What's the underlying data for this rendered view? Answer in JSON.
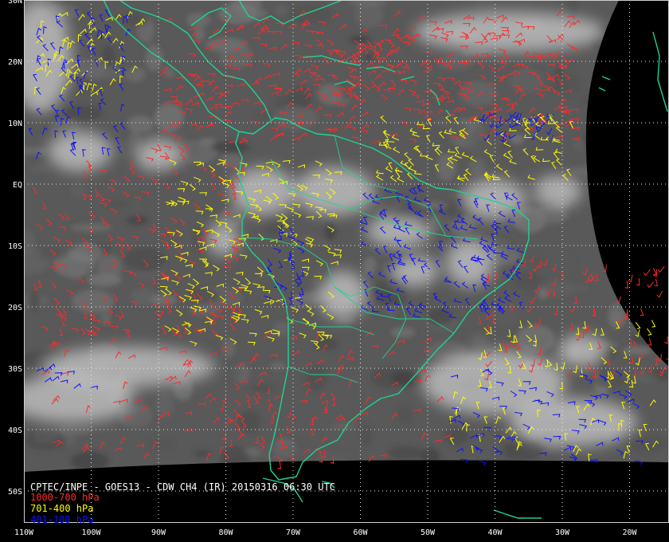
{
  "map": {
    "title": "CPTEC/INPE - GOES13 - CDW CH4 (IR) 20150316 06:30 UTC",
    "latitude_labels": [
      "30N",
      "20N",
      "10N",
      "EQ",
      "10S",
      "20S",
      "30S",
      "40S",
      "50S"
    ],
    "longitude_labels": [
      "110W",
      "100W",
      "90W",
      "80W",
      "70W",
      "60W",
      "50W",
      "40W",
      "30W",
      "20W"
    ],
    "lat_values": [
      30,
      20,
      10,
      0,
      -10,
      -20,
      -30,
      -40,
      -50
    ],
    "lon_values": [
      -110,
      -100,
      -90,
      -80,
      -70,
      -60,
      -50,
      -40,
      -30,
      -20
    ],
    "legend": [
      {
        "label": "1000-700 hPa",
        "color": "#ff2a2a"
      },
      {
        "label": "701-400 hPa",
        "color": "#ffff00"
      },
      {
        "label": "401-100 hPa",
        "color": "#1010ff"
      }
    ],
    "colors": {
      "coastline": "#1fd38f",
      "grid": "#e8e8e8",
      "background": "#000000",
      "imagery": "#5a5a5a"
    }
  }
}
